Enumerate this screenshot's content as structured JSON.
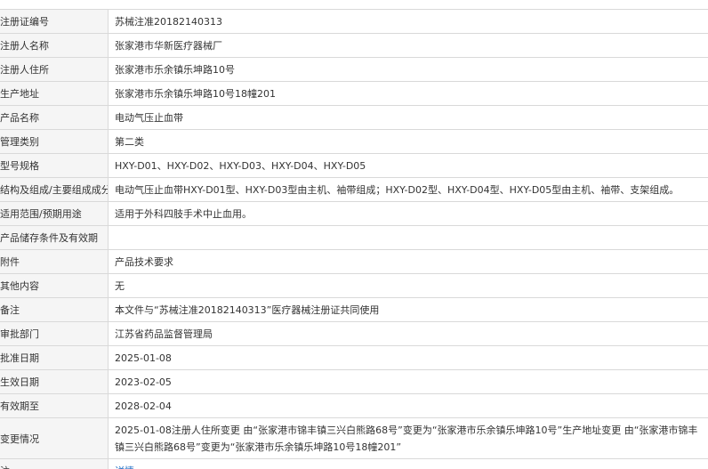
{
  "rows": [
    {
      "label": "注册证编号",
      "value": "苏械注准20182140313"
    },
    {
      "label": "注册人名称",
      "value": "张家港市华新医疗器械厂"
    },
    {
      "label": "注册人住所",
      "value": "张家港市乐余镇乐坤路10号"
    },
    {
      "label": "生产地址",
      "value": "张家港市乐余镇乐坤路10号18幢201"
    },
    {
      "label": "产品名称",
      "value": "电动气压止血带"
    },
    {
      "label": "管理类别",
      "value": "第二类"
    },
    {
      "label": "型号规格",
      "value": "HXY-D01、HXY-D02、HXY-D03、HXY-D04、HXY-D05"
    },
    {
      "label": "结构及组成/主要组成成分",
      "value": "电动气压止血带HXY-D01型、HXY-D03型由主机、袖带组成；HXY-D02型、HXY-D04型、HXY-D05型由主机、袖带、支架组成。"
    },
    {
      "label": "适用范围/预期用途",
      "value": "适用于外科四肢手术中止血用。"
    },
    {
      "label": "产品储存条件及有效期",
      "value": ""
    },
    {
      "label": "附件",
      "value": "产品技术要求"
    },
    {
      "label": "其他内容",
      "value": "无"
    },
    {
      "label": "备注",
      "value": "本文件与“苏械注准20182140313”医疗器械注册证共同使用"
    },
    {
      "label": "审批部门",
      "value": "江苏省药品监督管理局"
    },
    {
      "label": "批准日期",
      "value": "2025-01-08"
    },
    {
      "label": "生效日期",
      "value": "2023-02-05"
    },
    {
      "label": "有效期至",
      "value": "2028-02-04"
    },
    {
      "label": "变更情况",
      "value": "2025-01-08注册人住所变更 由“张家港市锦丰镇三兴白熊路68号”变更为“张家港市乐余镇乐坤路10号”生产地址变更 由“张家港市锦丰镇三兴白熊路68号”变更为“张家港市乐余镇乐坤路10号18幢201”"
    },
    {
      "label": "注",
      "value": "详情"
    }
  ]
}
